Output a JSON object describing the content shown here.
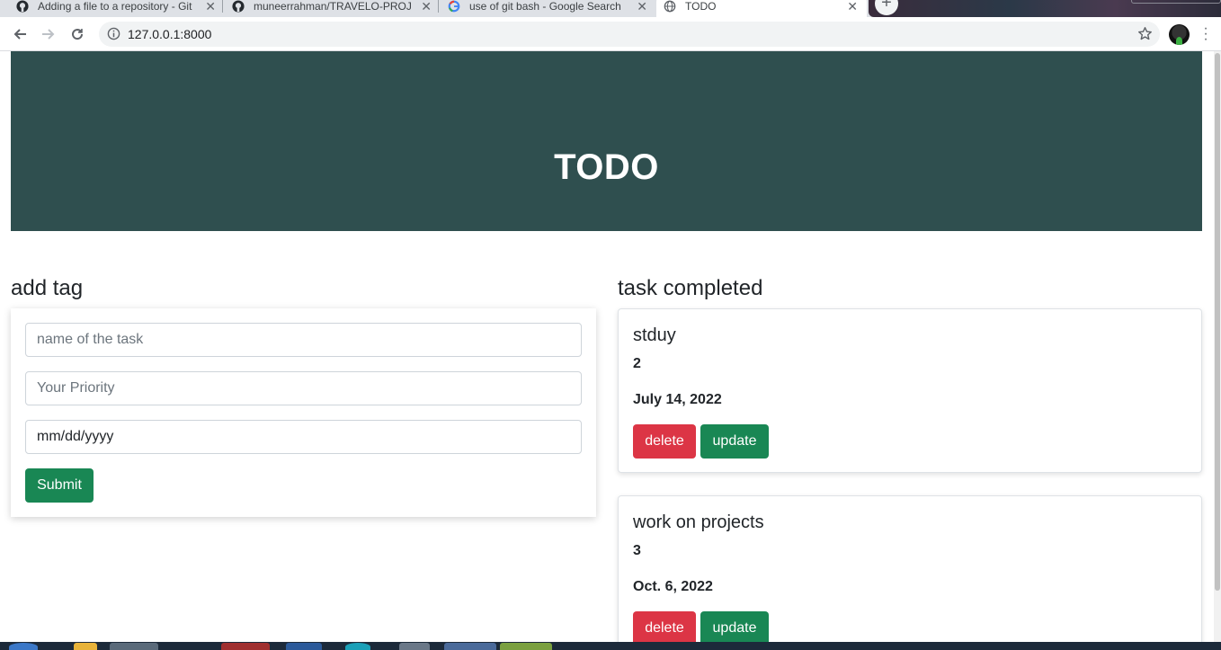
{
  "browser": {
    "tabs": [
      {
        "title": "Adding a file to a repository - Git",
        "icon": "github-icon",
        "active": false
      },
      {
        "title": "muneerrahman/TRAVELO-PROJE",
        "icon": "github-icon",
        "active": false
      },
      {
        "title": "use of git bash - Google Search",
        "icon": "google-icon",
        "active": false
      },
      {
        "title": "TODO",
        "icon": "globe-icon",
        "active": true
      }
    ],
    "url": "127.0.0.1:8000"
  },
  "page": {
    "header_title": "TODO",
    "add_section_title": "add tag",
    "form": {
      "task_name_placeholder": "name of the task",
      "priority_placeholder": "Your Priority",
      "date_placeholder": "mm/dd/yyyy",
      "submit_label": "Submit"
    },
    "completed_section_title": "task completed",
    "tasks": [
      {
        "name": "stduy",
        "priority": "2",
        "date": "July 14, 2022",
        "delete_label": "delete",
        "update_label": "update"
      },
      {
        "name": "work on projects",
        "priority": "3",
        "date": "Oct. 6, 2022",
        "delete_label": "delete",
        "update_label": "update"
      }
    ]
  },
  "colors": {
    "header_bg": "#2f4f4f",
    "success": "#198754",
    "danger": "#dc3545"
  }
}
